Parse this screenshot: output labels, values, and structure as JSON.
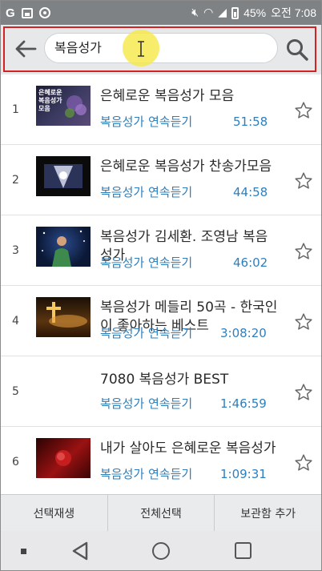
{
  "status_bar": {
    "app_letter": "G",
    "battery": "45%",
    "time": "오전 7:08"
  },
  "search": {
    "query": "복음성가"
  },
  "results": [
    {
      "num": "1",
      "title": "은혜로운 복음성가 모음",
      "subtitle": "복음성가 연속듣기",
      "duration": "51:58",
      "thumb_text": "은혜로운\n복음성가\n모음",
      "thumb_bg": "#3a3a55"
    },
    {
      "num": "2",
      "title": "은혜로운 복음성가 찬송가모음",
      "subtitle": "복음성가 연속듣기",
      "duration": "44:58",
      "thumb_text": "",
      "thumb_bg": "#0d0d0d"
    },
    {
      "num": "3",
      "title": "복음성가 김세환. 조영남 복음성가",
      "subtitle": "복음성가 연속듣기",
      "duration": "46:02",
      "thumb_text": "",
      "thumb_bg": "#0a1a3a"
    },
    {
      "num": "4",
      "title": "복음성가 메들리 50곡 - 한국인이 좋아하는 베스트",
      "subtitle": "복음성가 연속듣기",
      "duration": "3:08:20",
      "thumb_text": "",
      "thumb_bg": "#2a1808"
    },
    {
      "num": "5",
      "title": "7080 복음성가 BEST",
      "subtitle": "복음성가 연속듣기",
      "duration": "1:46:59",
      "thumb_text": "",
      "thumb_bg": ""
    },
    {
      "num": "6",
      "title": "내가 살아도 은혜로운 복음성가",
      "subtitle": "복음성가 연속듣기",
      "duration": "1:09:31",
      "thumb_text": "",
      "thumb_bg": "#3a0505"
    }
  ],
  "actions": {
    "play_selected": "선택재생",
    "select_all": "전체선택",
    "add_to_storage": "보관함 추가"
  },
  "colors": {
    "accent": "#2e7fbe",
    "highlight_border": "#d42222",
    "status_bar": "#7e8285"
  }
}
